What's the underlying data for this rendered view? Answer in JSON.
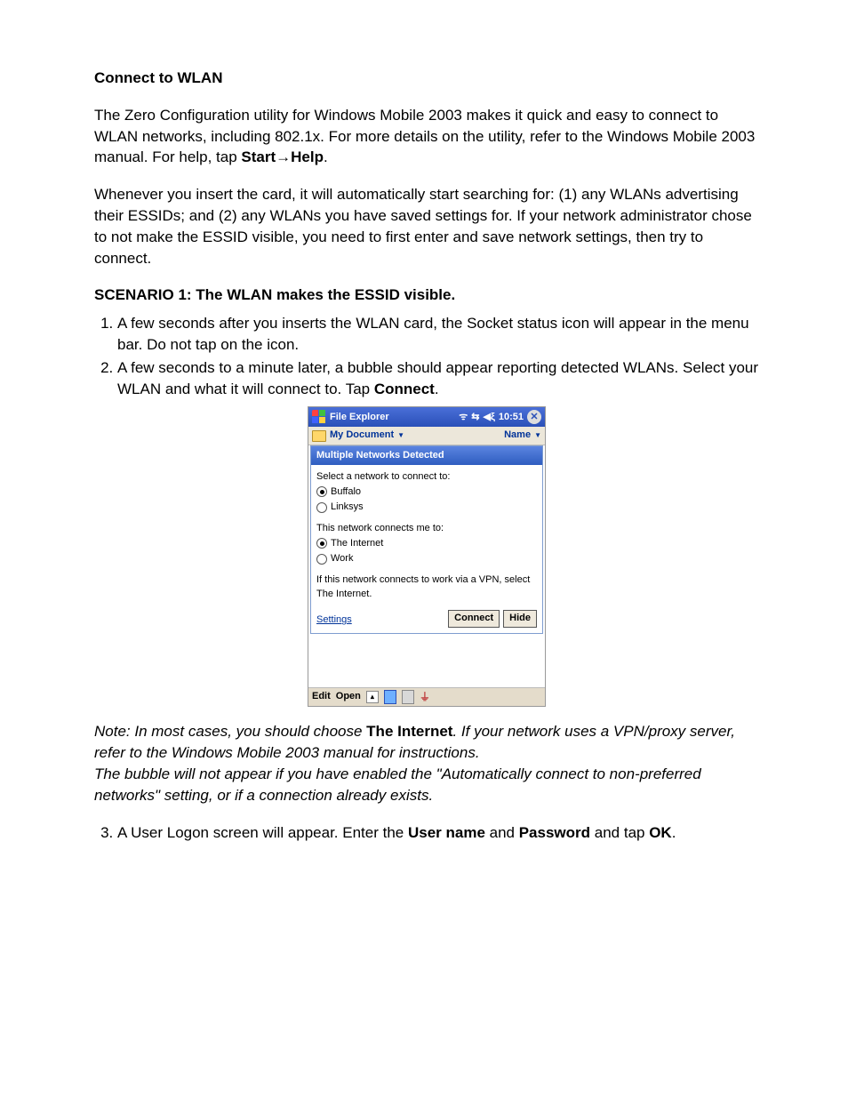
{
  "doc": {
    "heading": "Connect to WLAN",
    "para1_a": "The Zero Configuration utility for Windows Mobile 2003 makes it quick and easy to connect to WLAN networks, including 802.1x. For more details on the utility, refer to the Windows Mobile 2003 manual. For help, tap ",
    "para1_b1": "Start",
    "para1_arrow": "→",
    "para1_b2": "Help",
    "para1_c": ".",
    "para2": "Whenever you insert the card, it will automatically start searching for: (1) any WLANs advertising their ESSIDs; and (2) any WLANs you have saved settings for. If your network administrator chose to not make the ESSID visible, you need to first enter and save network settings, then try to connect.",
    "scenario1_heading": "SCENARIO 1: The WLAN makes the ESSID visible.",
    "step1": "A few seconds after you inserts the WLAN card, the Socket status icon will appear in the menu bar. Do not tap on the icon.",
    "step2_a": "A few seconds to a minute later, a bubble should appear reporting detected WLANs. Select your WLAN and what it will connect to. Tap ",
    "step2_b": "Connect",
    "step2_c": ".",
    "note_a": "Note: In most cases, you should choose ",
    "note_b": "The Internet",
    "note_c": ". If your network uses a VPN/proxy server, refer to the Windows Mobile 2003 manual for instructions.",
    "note_d": "The bubble will not appear if you have enabled the \"Automatically connect to non-preferred networks\" setting, or if a connection already exists.",
    "step3_a": "A User Logon screen will appear. Enter the ",
    "step3_b1": "User name",
    "step3_mid": " and ",
    "step3_b2": "Password",
    "step3_c": " and tap ",
    "step3_b3": "OK",
    "step3_d": "."
  },
  "shot": {
    "title": "File Explorer",
    "time": "10:51",
    "crumb": "My Document",
    "sort": "Name",
    "bubble_title": "Multiple Networks Detected",
    "select_prompt": "Select a network to connect to:",
    "net_opts": [
      "Buffalo",
      "Linksys"
    ],
    "net_selected_index": 0,
    "connect_prompt": "This network connects me to:",
    "connect_opts": [
      "The Internet",
      "Work"
    ],
    "connect_selected_index": 0,
    "vpn_hint": "If this network connects to work via a VPN, select The Internet.",
    "settings": "Settings",
    "btn_connect": "Connect",
    "btn_hide": "Hide",
    "edit": "Edit",
    "open": "Open"
  }
}
